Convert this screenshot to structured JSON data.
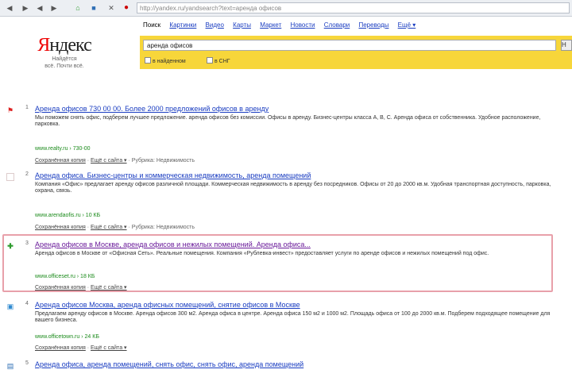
{
  "browser": {
    "url": "http://yandex.ru/yandsearch?text=аренда офисов",
    "nav_icons": [
      "back-icon",
      "forward-icon",
      "back-icon",
      "forward-icon",
      "home-icon",
      "bookmark-icon",
      "stop-icon"
    ]
  },
  "logo": {
    "brand_first": "Я",
    "brand_rest": "ндекс",
    "line1": "Найдётся",
    "line2": "всё. Почти всё."
  },
  "tabs": [
    "Поиск",
    "Картинки",
    "Видео",
    "Карты",
    "Маркет",
    "Новости",
    "Словари",
    "Переводы",
    "Ещё ▾"
  ],
  "search": {
    "query": "аренда офисов",
    "button_label": "Н",
    "option1": "в найденном",
    "option2": "в СНГ"
  },
  "results": [
    {
      "num": "1",
      "icon": "flag-icon",
      "title": "Аренда офисов 730 00 00. Более 2000 предложений офисов в аренду",
      "snippet": "Мы поможем снять офис, подберем лучшее предложение. аренда офисов без комиссии. Офисы в аренду. Бизнес-центры класса А, В, С. Аренда офиса от собственника. Удобное расположение, парковка.",
      "url": "www.realty.ru › 730-00",
      "links": [
        "Сохранённая копия",
        "Ещё с сайта ▾",
        "Рубрика: Недвижимость"
      ]
    },
    {
      "num": "2",
      "icon": "page-icon",
      "title": "Аренда офиса. Бизнес-центры и коммерческая недвижимость, аренда помещений",
      "snippet": "Компания «Офис» предлагает аренду офисов различной площади. Коммерческая недвижимость в аренду без посредников. Офисы от 20 до 2000 кв.м. Удобная транспортная доступность, парковка, охрана, связь.",
      "url": "www.arendaofis.ru › 10 КБ",
      "links": [
        "Сохранённая копия",
        "Ещё с сайта ▾",
        "Рубрика: Недвижимость"
      ]
    },
    {
      "num": "3",
      "icon": "plus-icon",
      "title": "Аренда офисов в Москве, аренда офисов и нежилых помещений. Аренда офиса...",
      "snippet": "Аренда офисов в Москве от «Офисная Сеть». Реальные помещения. Компания «Рублевка-инвест» предоставляет услуги по аренде офисов и нежилых помещений под офис.",
      "url": "www.officeset.ru › 18 КБ",
      "links": [
        "Сохранённая копия",
        "Ещё с сайта ▾"
      ]
    },
    {
      "num": "4",
      "icon": "document-icon",
      "title": "Аренда офисов Москва, аренда офисных помещений, снятие офисов в Москве",
      "snippet": "Предлагаем аренду офисов в Москве. Аренда офисов 300 м2. Аренда офиса в центре. Аренда офиса 150 м2 и 1000 м2. Площадь офиса от 100 до 2000 кв.м. Подберем подходящее помещение для вашего бизнеса.",
      "url": "www.officetown.ru › 24 КБ",
      "links": [
        "Сохранённая копия",
        "Ещё с сайта ▾"
      ]
    },
    {
      "num": "5",
      "icon": "document-icon",
      "title": "Аренда офиса, аренда помещений, снять офис, снять офис, аренда помещений",
      "snippet": "",
      "url": "",
      "links": []
    }
  ]
}
